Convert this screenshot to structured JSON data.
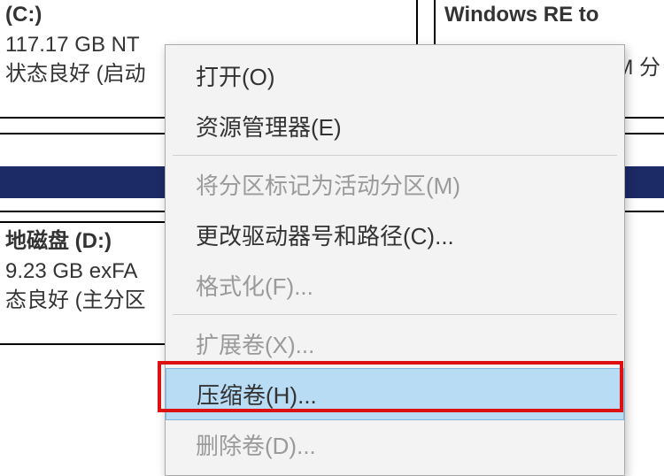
{
  "partitions": {
    "c": {
      "title": "(C:)",
      "size_line": "117.17 GB NT",
      "status_line": "状态良好 (启动"
    },
    "re": {
      "title": "Windows RE to",
      "status_line": "M 分"
    },
    "d": {
      "title": "地磁盘  (D:)",
      "size_line": "9.23 GB exFA",
      "status_line": "态良好 (主分区"
    }
  },
  "menu": {
    "open": "打开(O)",
    "explorer": "资源管理器(E)",
    "mark_active": "将分区标记为活动分区(M)",
    "change_letter": "更改驱动器号和路径(C)...",
    "format": "格式化(F)...",
    "extend": "扩展卷(X)...",
    "shrink": "压缩卷(H)...",
    "delete": "删除卷(D)..."
  }
}
